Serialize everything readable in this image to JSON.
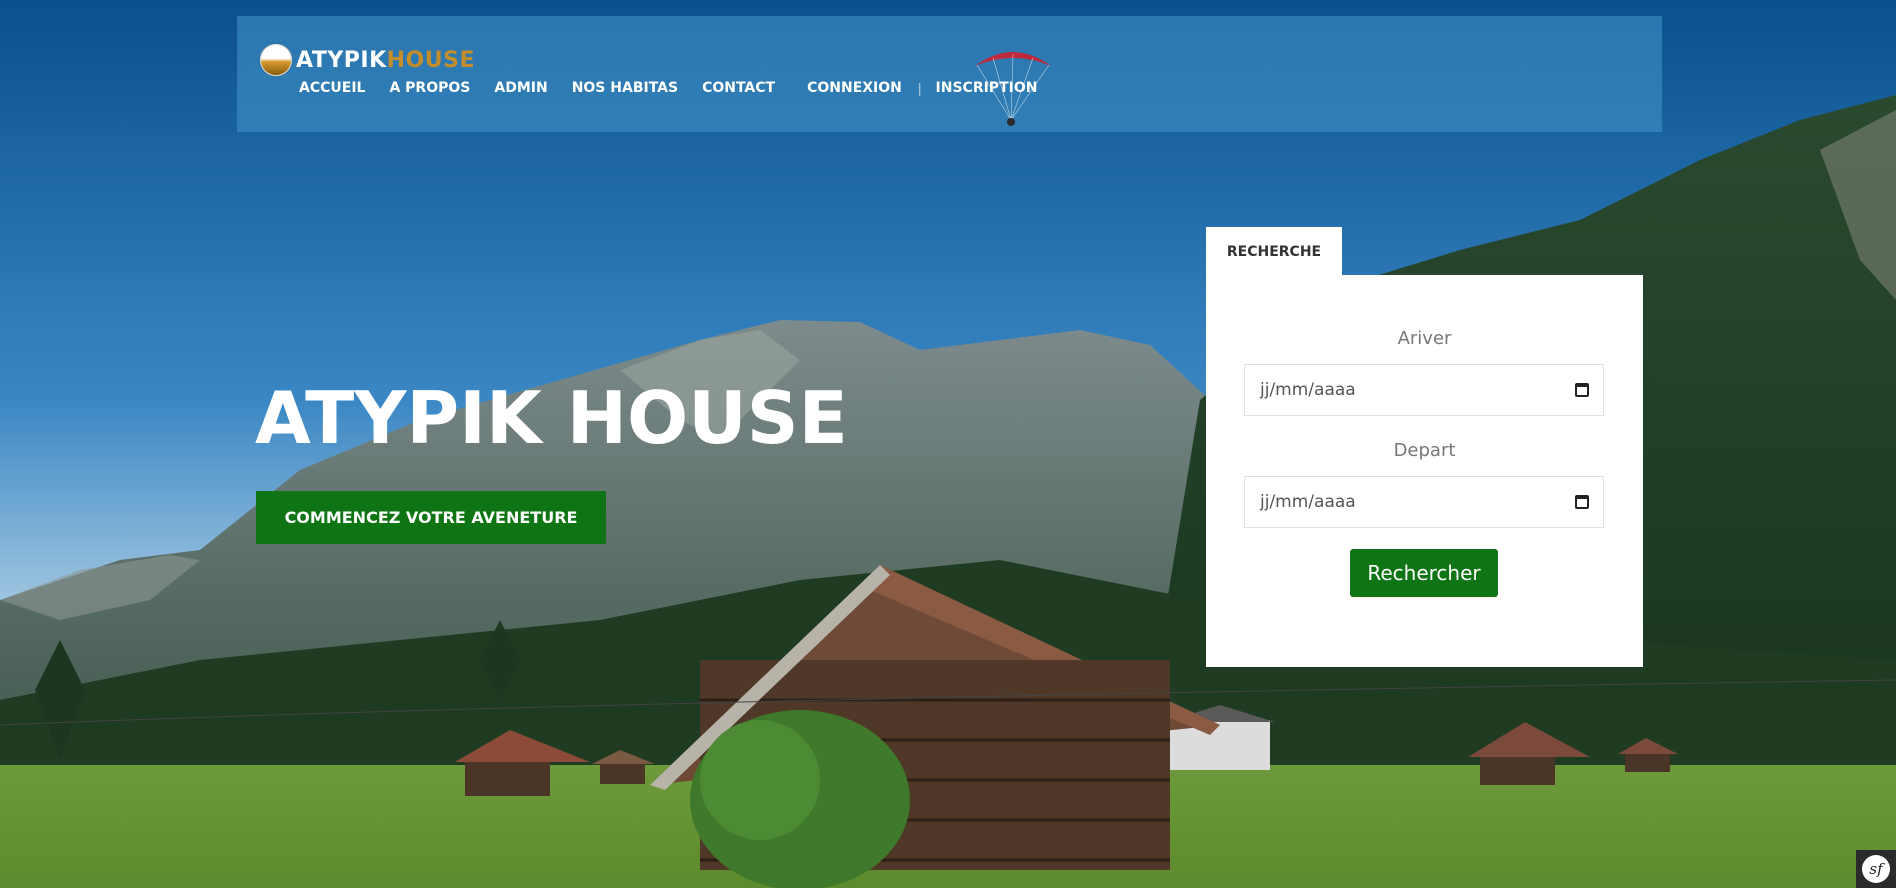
{
  "brand": {
    "name_part1": "ATYPIK",
    "name_part2": "HOUSE"
  },
  "nav": {
    "items": [
      "ACCUEIL",
      "A PROPOS",
      "ADMIN",
      "NOS HABITAS",
      "CONTACT",
      "CONNEXION",
      "INSCRIPTION"
    ],
    "separator": "|"
  },
  "hero": {
    "title": "ATYPIK HOUSE",
    "cta_label": "COMMENCEZ VOTRE AVENETURE"
  },
  "search": {
    "tab_label": "RECHERCHE",
    "arrive_label": "Ariver",
    "arrive_placeholder": "jj/mm/aaaa",
    "depart_label": "Depart",
    "depart_placeholder": "jj/mm/aaaa",
    "submit_label": "Rechercher"
  },
  "colors": {
    "accent_green": "#0f7514",
    "brand_gold": "#c28d2c",
    "header_overlay": "rgba(70,150,200,0.55)"
  },
  "icons": [
    "logo-icon",
    "calendar-icon",
    "paraglider-icon",
    "symfony-icon"
  ]
}
